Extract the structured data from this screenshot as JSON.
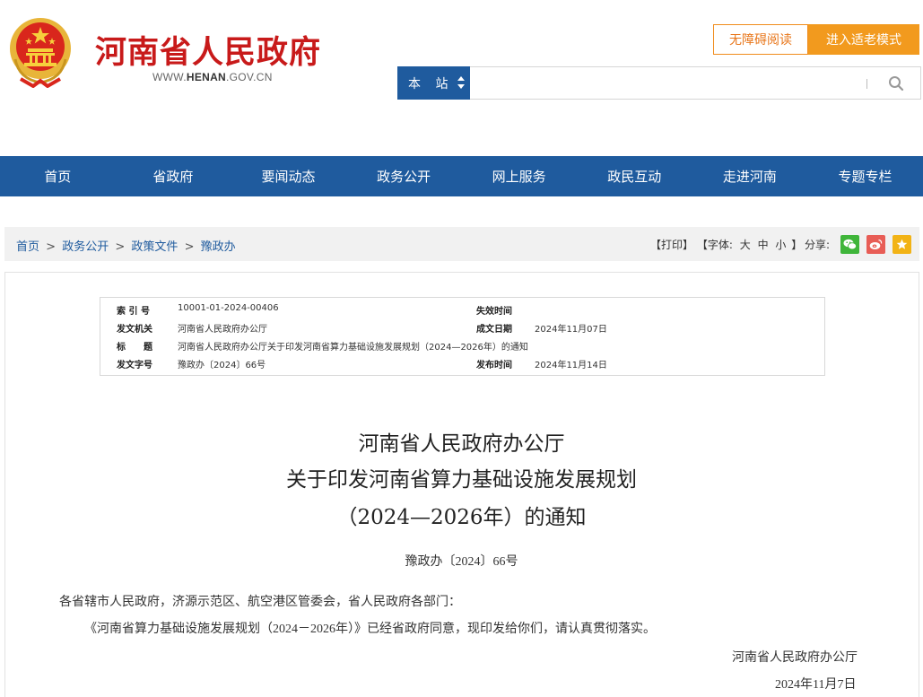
{
  "header": {
    "site_title": "河南省人民政府",
    "site_url_prefix": "WWW.",
    "site_url_domain": "HENAN",
    "site_url_suffix": ".GOV.CN",
    "accessibility_label": "无障碍阅读",
    "elder_mode_label": "进入适老模式",
    "search": {
      "scope_label": "本 站",
      "placeholder": "",
      "icon": "search-icon"
    }
  },
  "nav": {
    "items": [
      "首页",
      "省政府",
      "要闻动态",
      "政务公开",
      "网上服务",
      "政民互动",
      "走进河南",
      "专题专栏"
    ]
  },
  "breadcrumb": {
    "items": [
      "首页",
      "政务公开",
      "政策文件",
      "豫政办"
    ],
    "separator": ">"
  },
  "tools": {
    "print": "【打印】",
    "font_label": "【字体:",
    "font_large": "大",
    "font_medium": "中",
    "font_small": "小",
    "font_close": "】",
    "share_label": "分享:",
    "share_icons": [
      "wechat-icon",
      "weibo-icon",
      "favorite-icon"
    ]
  },
  "meta": {
    "index_label": "索 引 号",
    "index_value": "10001-01-2024-00406",
    "expire_label": "失效时间",
    "expire_value": "",
    "issuer_label": "发文机关",
    "issuer_value": "河南省人民政府办公厅",
    "written_label": "成文日期",
    "written_value": "2024年11月07日",
    "title_label": "标　　题",
    "title_value": "河南省人民政府办公厅关于印发河南省算力基础设施发展规划（2024—2026年）的通知",
    "docno_label": "发文字号",
    "docno_value": "豫政办〔2024〕66号",
    "publish_label": "发布时间",
    "publish_value": "2024年11月14日"
  },
  "document": {
    "title_line1": "河南省人民政府办公厅",
    "title_line2": "关于印发河南省算力基础设施发展规划",
    "title_line3": "（2024—2026年）的通知",
    "doc_number": "豫政办〔2024〕66号",
    "salutation": "各省辖市人民政府，济源示范区、航空港区管委会，省人民政府各部门：",
    "body": "《河南省算力基础设施发展规划（2024－2026年）》已经省政府同意，现印发给你们，请认真贯彻落实。",
    "signature": "河南省人民政府办公厅",
    "date": "2024年11月7日"
  },
  "colors": {
    "brand_blue": "#1f5b9e",
    "title_red": "#c81a1a",
    "accent_orange": "#f29a1e"
  }
}
